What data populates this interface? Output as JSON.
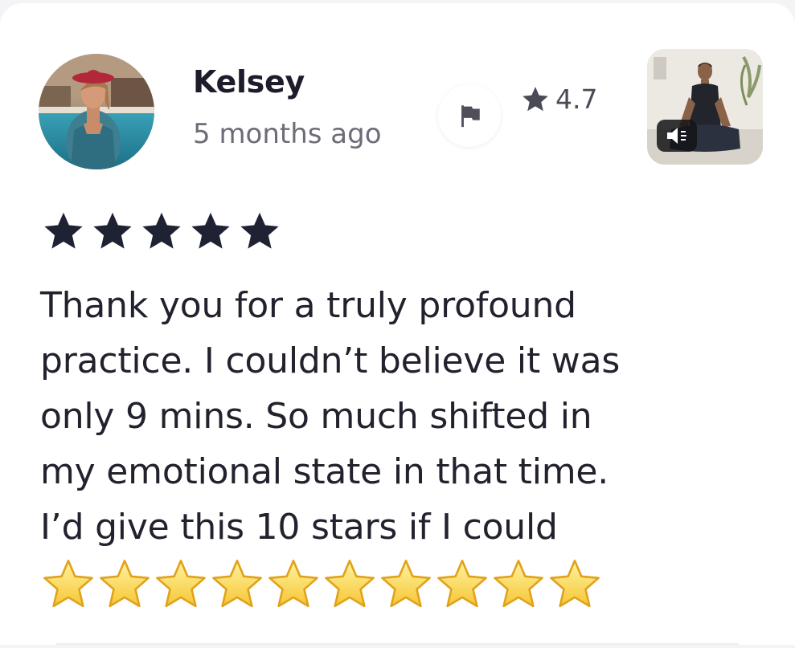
{
  "review": {
    "author_name": "Kelsey",
    "time_ago": "5 months ago",
    "rating_value": "4.7",
    "stars_given": 5,
    "text_lines": [
      "Thank you for a truly profound",
      "practice. I couldn’t believe it was",
      "only 9 mins. So much shifted in",
      "my emotional state in that time.",
      "I’d give this 10 stars if I could"
    ],
    "emoji_star_count": 10
  },
  "icons": {
    "flag": "flag-icon",
    "rating_star": "star-icon",
    "rating_stars": "star-icon",
    "sound": "speaker-icon",
    "emoji_star": "glowing-star-icon"
  },
  "colors": {
    "text_dark": "#1c1c2a",
    "text_muted": "#6d6d78",
    "star_dark": "#1f2233",
    "emoji_star_gold": "#f6c636"
  }
}
